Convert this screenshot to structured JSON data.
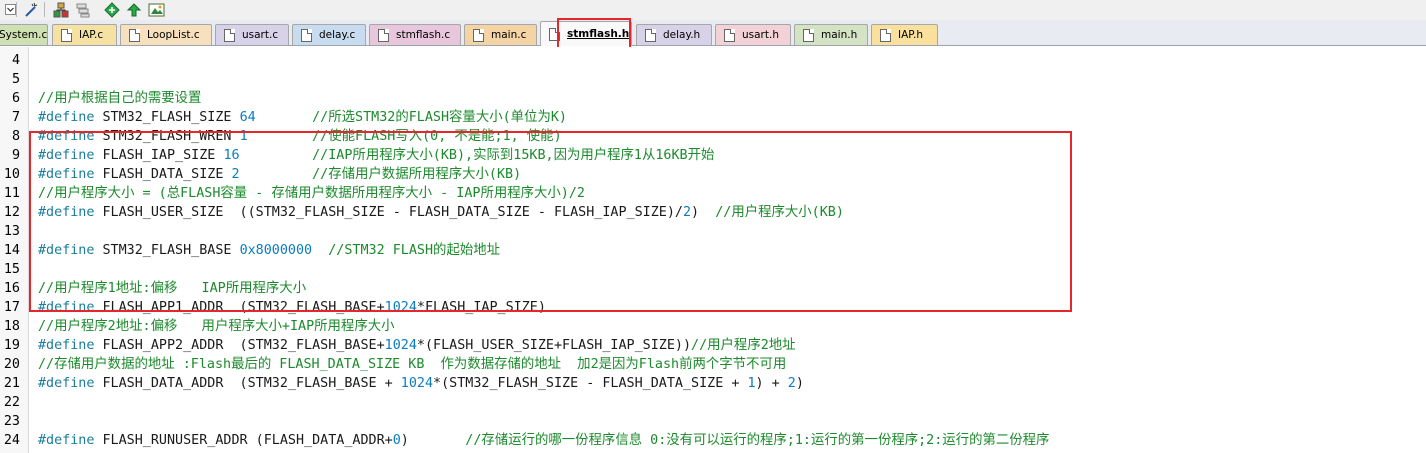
{
  "toolbar": {
    "icons": [
      "dropdown-arrow-icon",
      "magic-wand-icon",
      "translate-icon",
      "batch-icon",
      "diamond-icon",
      "tree-icon",
      "manage-icon"
    ]
  },
  "tabs": [
    {
      "label": "System.c",
      "color": "#cfe0b3"
    },
    {
      "label": "IAP.c",
      "color": "#f5e2a3"
    },
    {
      "label": "LoopList.c",
      "color": "#f6e0bd"
    },
    {
      "label": "usart.c",
      "color": "#d8d2e8"
    },
    {
      "label": "delay.c",
      "color": "#c8dbef"
    },
    {
      "label": "stmflash.c",
      "color": "#e8c7dc"
    },
    {
      "label": "main.c",
      "color": "#f4d3a4"
    },
    {
      "label": "stmflash.h",
      "color": "#f9f9f9",
      "active": true
    },
    {
      "label": "delay.h",
      "color": "#d8d2e8"
    },
    {
      "label": "usart.h",
      "color": "#f3d2d7"
    },
    {
      "label": "main.h",
      "color": "#d4e3c4"
    },
    {
      "label": "IAP.h",
      "color": "#f9e09c"
    }
  ],
  "editor": {
    "lines": [
      {
        "n": "4",
        "code": ""
      },
      {
        "n": "5",
        "code": ""
      },
      {
        "n": "6",
        "code": "//用户根据自己的需要设置"
      },
      {
        "n": "7",
        "code": "#define STM32_FLASH_SIZE 64       //所选STM32的FLASH容量大小(单位为K)"
      },
      {
        "n": "8",
        "code": "#define STM32_FLASH_WREN 1        //使能FLASH写入(0, 不是能;1, 使能)"
      },
      {
        "n": "9",
        "code": "#define FLASH_IAP_SIZE 16         //IAP所用程序大小(KB),实际到15KB,因为用户程序1从16KB开始"
      },
      {
        "n": "10",
        "code": "#define FLASH_DATA_SIZE 2         //存储用户数据所用程序大小(KB)"
      },
      {
        "n": "11",
        "code": "//用户程序大小 = (总FLASH容量 - 存储用户数据所用程序大小 - IAP所用程序大小)/2"
      },
      {
        "n": "12",
        "code": "#define FLASH_USER_SIZE  ((STM32_FLASH_SIZE - FLASH_DATA_SIZE - FLASH_IAP_SIZE)/2)  //用户程序大小(KB)"
      },
      {
        "n": "13",
        "code": ""
      },
      {
        "n": "14",
        "code": "#define STM32_FLASH_BASE 0x8000000  //STM32 FLASH的起始地址"
      },
      {
        "n": "15",
        "code": ""
      },
      {
        "n": "16",
        "code": "//用户程序1地址:偏移   IAP所用程序大小"
      },
      {
        "n": "17",
        "code": "#define FLASH_APP1_ADDR  (STM32_FLASH_BASE+1024*FLASH_IAP_SIZE)"
      },
      {
        "n": "18",
        "code": "//用户程序2地址:偏移   用户程序大小+IAP所用程序大小"
      },
      {
        "n": "19",
        "code": "#define FLASH_APP2_ADDR  (STM32_FLASH_BASE+1024*(FLASH_USER_SIZE+FLASH_IAP_SIZE))//用户程序2地址"
      },
      {
        "n": "20",
        "code": "//存储用户数据的地址 :Flash最后的 FLASH_DATA_SIZE KB  作为数据存储的地址  加2是因为Flash前两个字节不可用"
      },
      {
        "n": "21",
        "code": "#define FLASH_DATA_ADDR  (STM32_FLASH_BASE + 1024*(STM32_FLASH_SIZE - FLASH_DATA_SIZE + 1) + 2)"
      },
      {
        "n": "22",
        "code": ""
      },
      {
        "n": "23",
        "code": ""
      },
      {
        "n": "24",
        "code": "#define FLASH_RUNUSER_ADDR (FLASH_DATA_ADDR+0)       //存储运行的哪一份程序信息 0:没有可以运行的程序;1:运行的第一份程序;2:运行的第二份程序"
      }
    ]
  }
}
